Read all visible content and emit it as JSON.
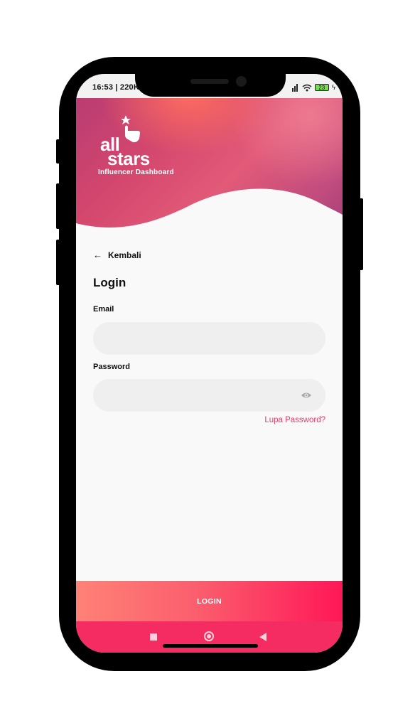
{
  "status_bar": {
    "time": "16:53 | 220K",
    "battery": "23"
  },
  "header": {
    "logo_line1": "all",
    "logo_line2": "stars",
    "subtitle": "Influencer Dashboard"
  },
  "back": {
    "label": "Kembali"
  },
  "form": {
    "title": "Login",
    "email_label": "Email",
    "email_value": "",
    "password_label": "Password",
    "password_value": "",
    "forgot_label": "Lupa Password?"
  },
  "login_button": {
    "label": "LOGIN"
  },
  "colors": {
    "accent": "#e23e6b",
    "button_start": "#ff8277",
    "button_end": "#ff1757",
    "navbar": "#f42c61"
  },
  "icons": [
    "back-arrow-icon",
    "eye-icon",
    "hand-star-icon",
    "wifi-icon",
    "battery-icon",
    "charging-icon"
  ]
}
